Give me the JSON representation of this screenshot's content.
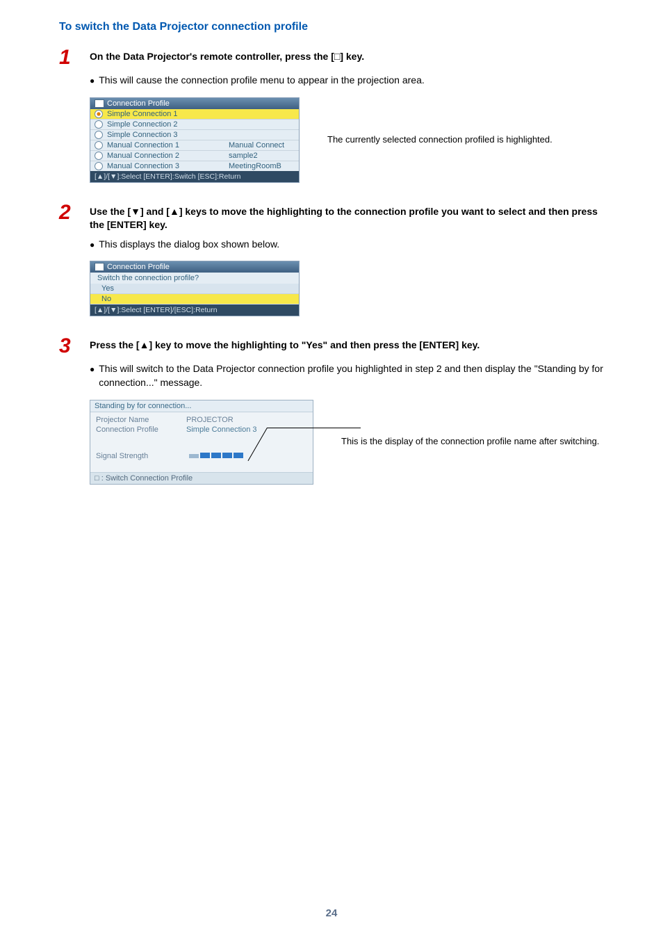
{
  "heading": "To switch the Data Projector connection profile",
  "step1": {
    "num": "1",
    "title": "On the Data Projector's remote controller, press the [□] key.",
    "bullet": "This will cause the connection profile menu to appear in the projection area.",
    "caption": "The currently selected connection profiled is highlighted."
  },
  "ui1": {
    "title": "Connection Profile",
    "rows": [
      {
        "label": "Simple Connection 1",
        "extra": "",
        "selected": true
      },
      {
        "label": "Simple Connection 2",
        "extra": "",
        "selected": false
      },
      {
        "label": "Simple Connection 3",
        "extra": "",
        "selected": false
      },
      {
        "label": "Manual Connection 1",
        "extra": "Manual Connect",
        "selected": false
      },
      {
        "label": "Manual Connection 2",
        "extra": "sample2",
        "selected": false
      },
      {
        "label": "Manual Connection 3",
        "extra": "MeetingRoomB",
        "selected": false
      }
    ],
    "footer": "[▲]/[▼]:Select [ENTER]:Switch [ESC]:Return"
  },
  "step2": {
    "num": "2",
    "title": "Use the [▼] and [▲] keys to move the highlighting to the connection profile you want to select and then press the [ENTER] key.",
    "bullet": "This displays the dialog box shown below."
  },
  "ui2": {
    "title": "Connection Profile",
    "question": "Switch the connection profile?",
    "yes": "Yes",
    "no": "No",
    "footer": "[▲]/[▼]:Select [ENTER]/[ESC]:Return"
  },
  "step3": {
    "num": "3",
    "title": "Press the [▲] key to move the highlighting to \"Yes\" and then press the [ENTER] key.",
    "bullet": "This will switch to the Data Projector connection profile you highlighted in step 2 and then display the \"Standing by for connection...\" message.",
    "caption": "This is the display of the connection profile name after switching."
  },
  "ui3": {
    "top": "Standing by for connection...",
    "rows": [
      {
        "k": "Projector Name",
        "v": "PROJECTOR"
      },
      {
        "k": "Connection Profile",
        "v": "Simple Connection 3"
      }
    ],
    "signal_label": "Signal Strength",
    "foot": "□ : Switch Connection Profile"
  },
  "pageNumber": "24"
}
